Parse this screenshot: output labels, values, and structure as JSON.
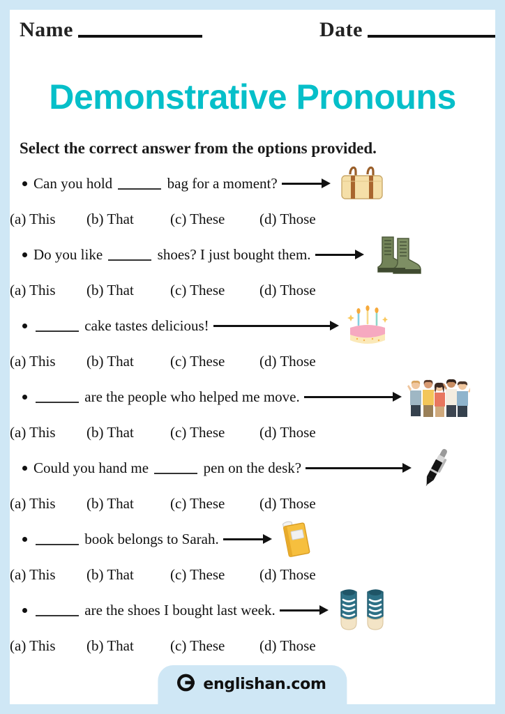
{
  "colors": {
    "border": "#cfe7f5",
    "title": "#06bfc9",
    "text": "#111111",
    "rule": "#111111"
  },
  "header": {
    "name_label": "Name",
    "date_label": "Date"
  },
  "title": "Demonstrative Pronouns",
  "instruction": "Select the correct answer from the options provided.",
  "options": [
    "(a) This",
    "(b) That",
    "(c) These",
    "(d) Those"
  ],
  "questions": [
    {
      "before": "Can you hold",
      "after": "bag for a moment?",
      "image": "handbag-image",
      "arrow_length": 58,
      "options": [
        "(a) This",
        "(b) That",
        "(c) These",
        "(d) Those"
      ]
    },
    {
      "before": "Do you like",
      "after": "shoes? I just bought them.",
      "image": "boots-image",
      "arrow_length": 58,
      "options": [
        "(a) This",
        "(b) That",
        "(c) These",
        "(d) Those"
      ]
    },
    {
      "before": "",
      "after": "cake tastes delicious!",
      "image": "birthday-cake-image",
      "arrow_length": 168,
      "options": [
        "(a) This",
        "(b) That",
        "(c) These",
        "(d) Those"
      ]
    },
    {
      "before": "",
      "after": "are the people who helped me move.",
      "image": "group-of-people-image",
      "arrow_length": 128,
      "options": [
        "(a) This",
        "(b) That",
        "(c) These",
        "(d) Those"
      ]
    },
    {
      "before": "Could you hand me",
      "after": "pen on the desk?",
      "image": "pen-image",
      "arrow_length": 140,
      "options": [
        "(a) This",
        "(b) That",
        "(c) These",
        "(d) Those"
      ]
    },
    {
      "before": "",
      "after": "book belongs to Sarah.",
      "image": "book-image",
      "arrow_length": 58,
      "options": [
        "(a) This",
        "(b) That",
        "(c) These",
        "(d) Those"
      ]
    },
    {
      "before": "",
      "after": "are the shoes I bought last week.",
      "image": "sneakers-image",
      "arrow_length": 58,
      "options": [
        "(a) This",
        "(b) That",
        "(c) These",
        "(d) Those"
      ]
    }
  ],
  "footer": {
    "brand": "englishan.com",
    "logo": "englishan-e-logo"
  }
}
